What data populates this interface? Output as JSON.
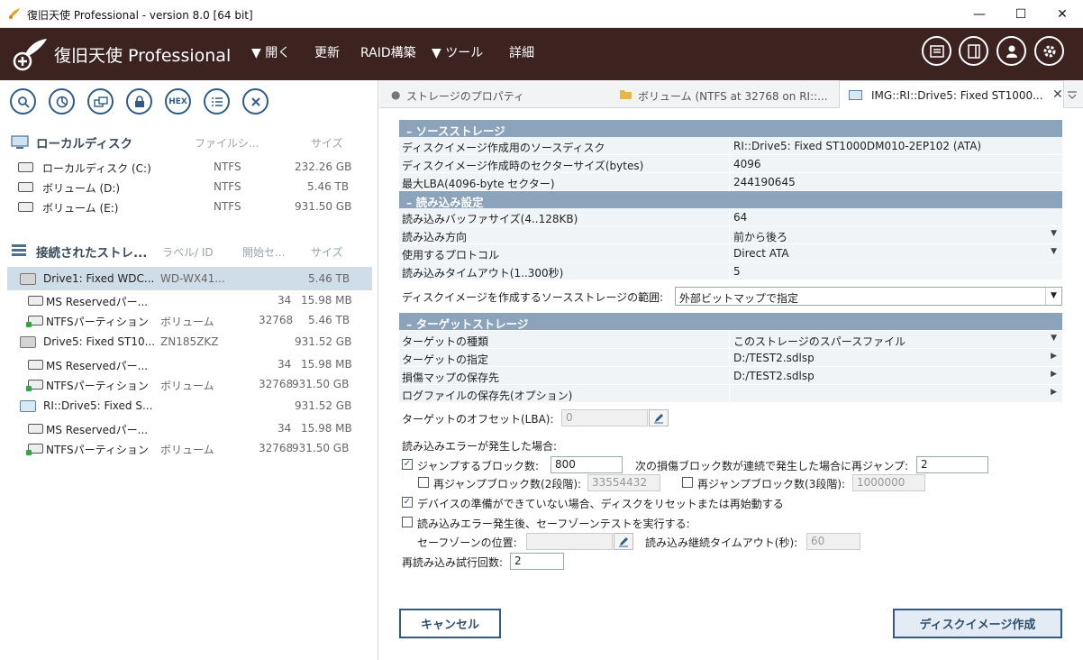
{
  "window": {
    "title": "復旧天使 Professional - version 8.0 [64 bit]",
    "min": "—",
    "max": "☐",
    "close": "✕"
  },
  "header": {
    "logo": "復旧天使 Professional",
    "menu": [
      "▼ 開く",
      "更新",
      "RAID構築",
      "▼ ツール",
      "詳細"
    ],
    "icons": [
      "list-view-icon",
      "panel-icon",
      "user-icon",
      "settings-icon"
    ]
  },
  "left": {
    "toolbar_icons": [
      "search-icon",
      "chart-icon",
      "copy-icon",
      "lock-icon",
      "hex-icon",
      "list-icon",
      "close-icon"
    ],
    "hex_label": "HEX",
    "local_section": {
      "title": "ローカルディスク",
      "cols": [
        "ファイルシ...",
        "サイズ"
      ],
      "items": [
        {
          "name": "ローカルディスク (C:)",
          "fs": "NTFS",
          "size": "232.26 GB"
        },
        {
          "name": "ボリューム (D:)",
          "fs": "NTFS",
          "size": "5.46 TB"
        },
        {
          "name": "ボリューム (E:)",
          "fs": "NTFS",
          "size": "931.50 GB"
        }
      ]
    },
    "connected_section": {
      "title": "接続されたストレ...",
      "cols": [
        "ラベル/ ID",
        "開始セ...",
        "サイズ"
      ],
      "items": [
        {
          "name": "Drive1: Fixed WDC...",
          "label": "WD-WX41...",
          "start": "",
          "size": "5.46 TB"
        },
        {
          "name": "MS Reservedパー...",
          "label": "",
          "start": "34",
          "size": "15.98 MB"
        },
        {
          "name": "NTFSパーティション",
          "label": "ボリューム",
          "start": "32768",
          "size": "5.46 TB"
        },
        {
          "name": "Drive5: Fixed ST10...",
          "label": "ZN185ZKZ",
          "start": "",
          "size": "931.52 GB"
        },
        {
          "name": "MS Reservedパー...",
          "label": "",
          "start": "34",
          "size": "15.98 MB"
        },
        {
          "name": "NTFSパーティション",
          "label": "ボリューム",
          "start": "32768",
          "size": "931.50 GB"
        },
        {
          "name": "RI::Drive5: Fixed S...",
          "label": "",
          "start": "",
          "size": "931.52 GB"
        },
        {
          "name": "MS Reservedパー...",
          "label": "",
          "start": "34",
          "size": "15.98 MB"
        },
        {
          "name": "NTFSパーティション",
          "label": "ボリューム",
          "start": "32768",
          "size": "931.50 GB"
        }
      ]
    }
  },
  "tabs": [
    {
      "label": "ストレージのプロパティ"
    },
    {
      "label": "ボリューム (NTFS at 32768 on RI::..."
    },
    {
      "label": "IMG::RI::Drive5: Fixed ST1000..."
    }
  ],
  "source": {
    "header": "–  ソースストレージ",
    "rows": [
      {
        "k": "ディスクイメージ作成用のソースディスク",
        "v": "RI::Drive5: Fixed ST1000DM010-2EP102 (ATA)"
      },
      {
        "k": "ディスクイメージ作成時のセクターサイズ(bytes)",
        "v": "4096"
      },
      {
        "k": "最大LBA(4096-byte セクター)",
        "v": "244190645"
      }
    ]
  },
  "read": {
    "header": "–  読み込み設定",
    "rows": [
      {
        "k": "読み込みバッファサイズ(4..128KB)",
        "v": "64"
      },
      {
        "k": "読み込み方向",
        "v": "前から後ろ"
      },
      {
        "k": "使用するプロトコル",
        "v": "Direct ATA"
      },
      {
        "k": "読み込みタイムアウト(1..300秒)",
        "v": "5"
      }
    ]
  },
  "range": {
    "label": "ディスクイメージを作成するソースストレージの範囲:",
    "value": "外部ビットマップで指定"
  },
  "target": {
    "header": "–  ターゲットストレージ",
    "rows": [
      {
        "k": "ターゲットの種類",
        "v": "このストレージのスパースファイル"
      },
      {
        "k": "ターゲットの指定",
        "v": "D:/TEST2.sdlsp"
      },
      {
        "k": "損傷マップの保存先",
        "v": "D:/TEST2.sdlsp"
      },
      {
        "k": "ログファイルの保存先(オプション)",
        "v": ""
      }
    ]
  },
  "offset": {
    "label": "ターゲットのオフセット(LBA):",
    "value": "0"
  },
  "errors": {
    "title": "読み込みエラーが発生した場合:",
    "jump_label": "ジャンプするブロック数:",
    "jump_value": "800",
    "rejump_label": "次の損傷ブロック数が連続で発生した場合に再ジャンプ:",
    "rejump_value": "2",
    "rejump2_label": "再ジャンプブロック数(2段階):",
    "rejump2_value": "33554432",
    "rejump3_label": "再ジャンプブロック数(3段階):",
    "rejump3_value": "1000000",
    "reset_label": "デバイスの準備ができていない場合、ディスクをリセットまたは再始動する",
    "safezone_label": "読み込みエラー発生後、セーフゾーンテストを実行する:",
    "safezone_pos_label": "セーフゾーンの位置:",
    "safezone_pos_value": "",
    "timeout_label": "読み込み継続タイムアウト(秒):",
    "timeout_value": "60",
    "retry_label": "再読み込み試行回数:",
    "retry_value": "2"
  },
  "buttons": {
    "cancel": "キャンセル",
    "create": "ディスクイメージ作成"
  }
}
